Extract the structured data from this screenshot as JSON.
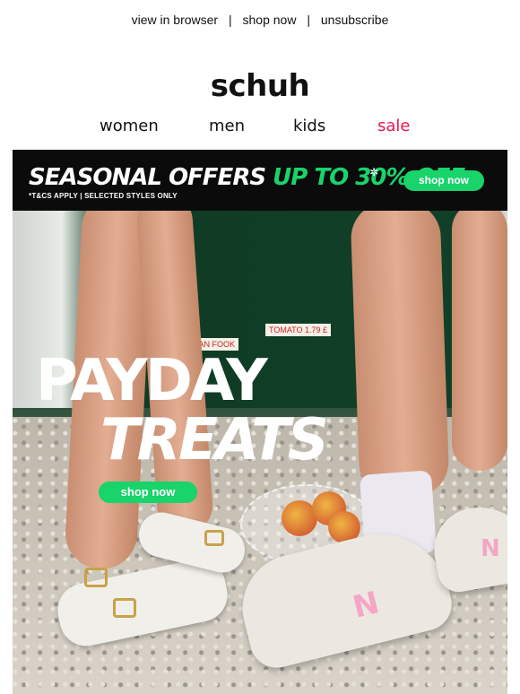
{
  "top_links": {
    "view_in_browser": "view in browser",
    "shop_now": "shop now",
    "unsubscribe": "unsubscribe",
    "separator": "|"
  },
  "brand": {
    "logo_text": "schuh"
  },
  "nav": {
    "women": "women",
    "men": "men",
    "kids": "kids",
    "sale": "sale",
    "sale_color": "#e5174f"
  },
  "banner": {
    "headline_white": "SEASONAL OFFERS",
    "headline_green": "UP TO 30% OFF",
    "star": "✲",
    "terms": "*T&CS APPLY  |  SELECTED STYLES ONLY",
    "button": "shop now",
    "accent_color": "#19d36b"
  },
  "hero": {
    "line1": "PAYDAY",
    "line2": "TREATS",
    "button": "shop now",
    "sign1": "MAN FOOK",
    "sign2": "TOMATO 1.79 £"
  }
}
